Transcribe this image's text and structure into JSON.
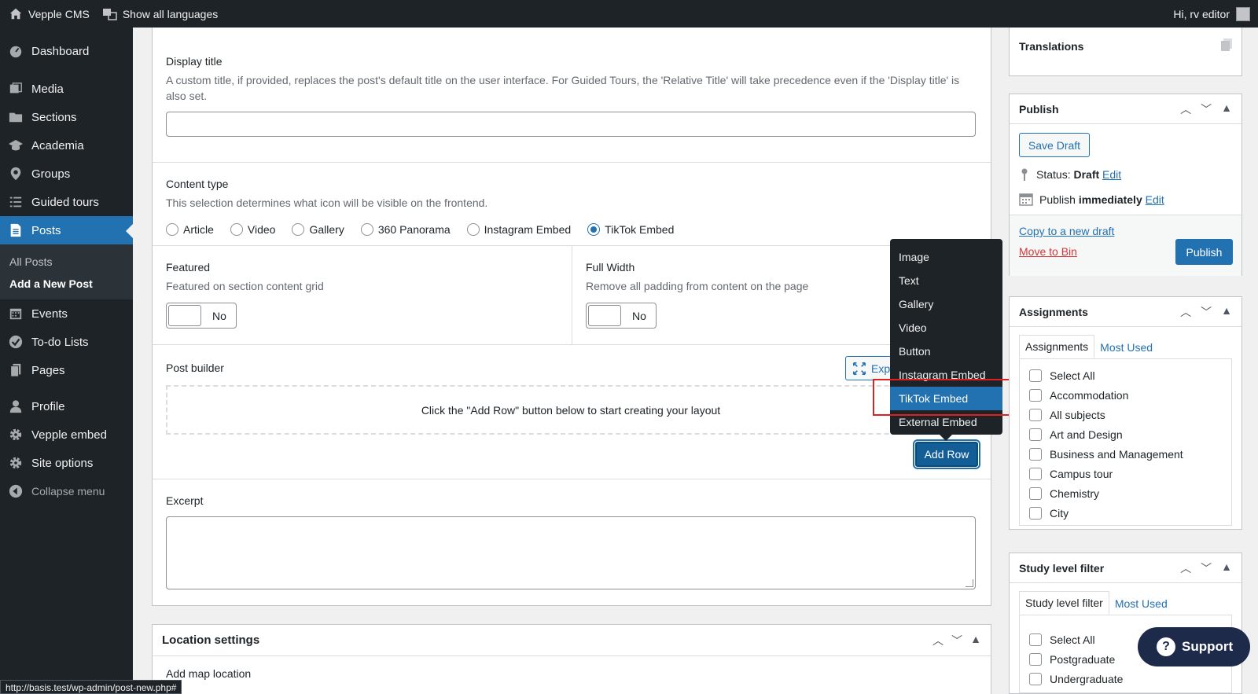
{
  "adminbar": {
    "site_name": "Vepple CMS",
    "languages": "Show all languages",
    "greeting": "Hi, rv editor"
  },
  "sidebar": {
    "items": [
      {
        "label": "Dashboard",
        "icon": "dashboard-icon"
      },
      {
        "label": "Media",
        "icon": "media-icon"
      },
      {
        "label": "Sections",
        "icon": "folder-icon"
      },
      {
        "label": "Academia",
        "icon": "graduation-cap-icon"
      },
      {
        "label": "Groups",
        "icon": "location-pin-icon"
      },
      {
        "label": "Guided tours",
        "icon": "list-icon"
      },
      {
        "label": "Posts",
        "icon": "posts-icon"
      },
      {
        "label": "Events",
        "icon": "calendar-icon"
      },
      {
        "label": "To-do Lists",
        "icon": "check-circle-icon"
      },
      {
        "label": "Pages",
        "icon": "pages-icon"
      },
      {
        "label": "Profile",
        "icon": "user-icon"
      },
      {
        "label": "Vepple embed",
        "icon": "gear-icon"
      },
      {
        "label": "Site options",
        "icon": "gear-icon"
      }
    ],
    "posts_sub": [
      "All Posts",
      "Add a New Post"
    ],
    "collapse": "Collapse menu"
  },
  "main": {
    "display_title": {
      "label": "Display title",
      "desc": "A custom title, if provided, replaces the post's default title on the user interface. For Guided Tours, the 'Relative Title' will take precedence even if the 'Display title' is also set.",
      "value": ""
    },
    "content_type": {
      "label": "Content type",
      "desc": "This selection determines what icon will be visible on the frontend.",
      "options": [
        "Article",
        "Video",
        "Gallery",
        "360 Panorama",
        "Instagram Embed",
        "TikTok Embed"
      ],
      "selected": "TikTok Embed"
    },
    "featured": {
      "label": "Featured",
      "desc": "Featured on section content grid",
      "toggle": "No"
    },
    "full_width": {
      "label": "Full Width",
      "desc": "Remove all padding from content on the page",
      "toggle": "No"
    },
    "post_builder": {
      "label": "Post builder",
      "empty_text": "Click the \"Add Row\" button below to start creating your layout",
      "expand_label": "Exp",
      "add_row": "Add Row"
    },
    "excerpt": {
      "label": "Excerpt"
    },
    "dropdown": {
      "items": [
        "Image",
        "Text",
        "Gallery",
        "Video",
        "Button",
        "Instagram Embed",
        "TikTok Embed",
        "External Embed"
      ],
      "selected": "TikTok Embed"
    }
  },
  "location": {
    "title": "Location settings",
    "add_map": "Add map location",
    "partial": "... "
  },
  "right": {
    "translations": {
      "title": "Translations"
    },
    "publish": {
      "title": "Publish",
      "save_draft": "Save Draft",
      "status_label": "Status:",
      "status_value": "Draft",
      "status_edit": "Edit",
      "publish_label": "Publish",
      "publish_value": "immediately",
      "publish_edit": "Edit",
      "copy_draft": "Copy to a new draft",
      "move_bin": "Move to Bin",
      "publish_btn": "Publish"
    },
    "assignments": {
      "title": "Assignments",
      "tab_all": "Assignments",
      "tab_used": "Most Used",
      "items": [
        "Select All",
        "Accommodation",
        "All subjects",
        "Art and Design",
        "Business and Management",
        "Campus tour",
        "Chemistry",
        "City"
      ]
    },
    "study": {
      "title": "Study level filter",
      "tab_all": "Study level filter",
      "tab_used": "Most Used",
      "items": [
        "Select All",
        "Postgraduate",
        "Undergraduate"
      ]
    }
  },
  "support": "Support",
  "statusbar": "http://basis.test/wp-admin/post-new.php#"
}
